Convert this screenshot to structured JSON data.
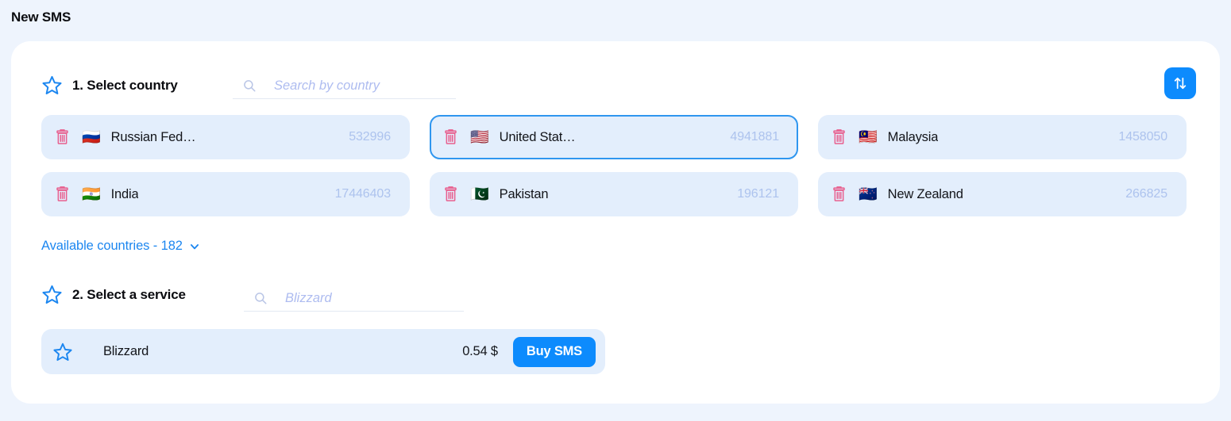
{
  "page": {
    "title": "New SMS"
  },
  "colors": {
    "page_background": "#eef4fd",
    "card_background": "#ffffff",
    "accent_blue": "#0d8bfd",
    "selected_border": "#2f96ef",
    "item_background": "#e3eefc",
    "trash_pink": "#e8608f",
    "count_text": "#adc3ee",
    "placeholder": "#aebcf0"
  },
  "country_section": {
    "step_label": "1. Select country",
    "star_icon": "star-outline-icon",
    "search": {
      "icon": "search-icon",
      "placeholder": "Search by country",
      "value": ""
    },
    "sort_button": {
      "icon": "sort-arrows-icon",
      "label": ""
    },
    "items": [
      {
        "flag": "🇷🇺",
        "name": "Russian Fed…",
        "count": "532996",
        "selected": false,
        "delete_icon": "trash-icon"
      },
      {
        "flag": "🇺🇸",
        "name": "United Stat…",
        "count": "4941881",
        "selected": true,
        "delete_icon": "trash-icon"
      },
      {
        "flag": "🇲🇾",
        "name": "Malaysia",
        "count": "1458050",
        "selected": false,
        "delete_icon": "trash-icon"
      },
      {
        "flag": "🇮🇳",
        "name": "India",
        "count": "17446403",
        "selected": false,
        "delete_icon": "trash-icon"
      },
      {
        "flag": "🇵🇰",
        "name": "Pakistan",
        "count": "196121",
        "selected": false,
        "delete_icon": "trash-icon"
      },
      {
        "flag": "🇳🇿",
        "name": "New Zealand",
        "count": "266825",
        "selected": false,
        "delete_icon": "trash-icon"
      }
    ],
    "available_link": {
      "label": "Available countries - 182",
      "icon": "chevron-down-icon"
    }
  },
  "service_section": {
    "step_label": "2. Select a service",
    "star_icon": "star-outline-icon",
    "search": {
      "icon": "search-icon",
      "placeholder": "Blizzard",
      "value": ""
    },
    "items": [
      {
        "favorite_icon": "star-outline-icon",
        "name": "Blizzard",
        "price": "0.54 $",
        "buy_label": "Buy SMS"
      }
    ]
  }
}
